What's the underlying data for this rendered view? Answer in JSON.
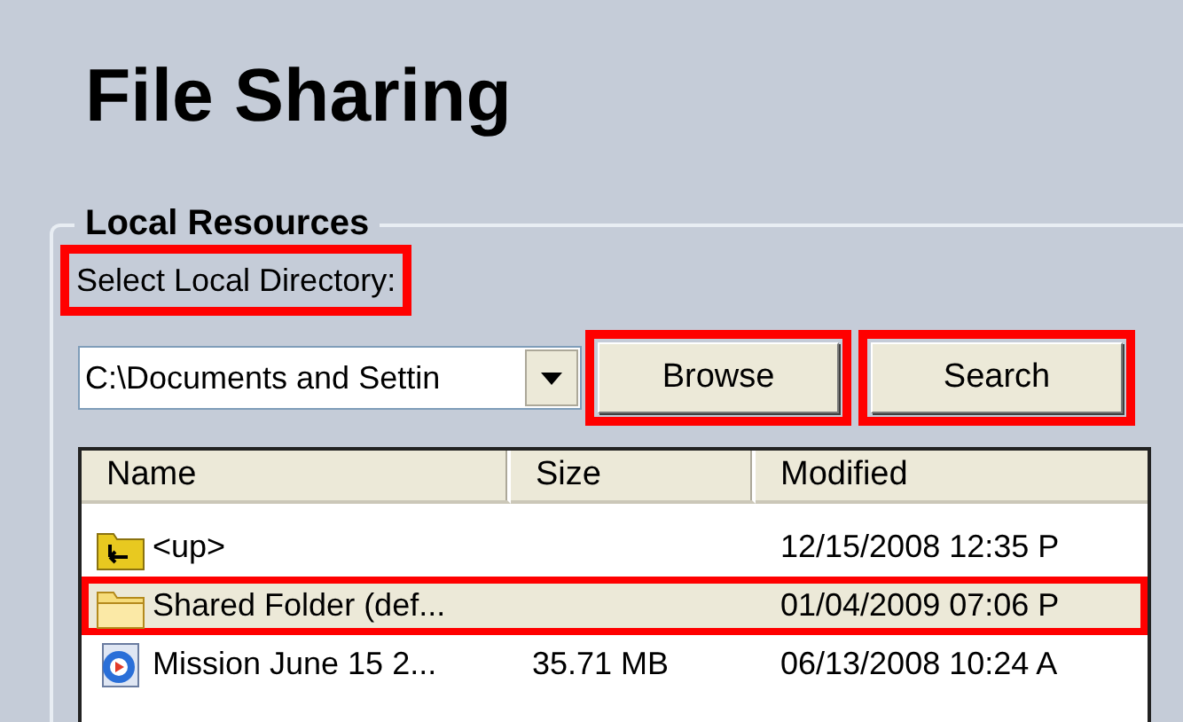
{
  "title": "File Sharing",
  "group": {
    "legend": "Local Resources"
  },
  "directory": {
    "label": "Select Local Directory:",
    "label_highlighted": true,
    "value": "C:\\Documents and Settin"
  },
  "buttons": [
    {
      "label": "Browse",
      "highlighted": true
    },
    {
      "label": "Search",
      "highlighted": true
    }
  ],
  "table": {
    "columns": [
      "Name",
      "Size",
      "Modified"
    ],
    "rows": [
      {
        "kind": "up-folder",
        "name": "<up>",
        "size": "",
        "modified": "12/15/2008 12:35 P",
        "selected": false,
        "highlighted": false
      },
      {
        "kind": "folder",
        "name": "Shared Folder (def...",
        "size": "",
        "modified": "01/04/2009 07:06 P",
        "selected": true,
        "highlighted": true
      },
      {
        "kind": "media",
        "name": "Mission June 15 2...",
        "size": "35.71 MB",
        "modified": "06/13/2008 10:24 A",
        "selected": false,
        "highlighted": false
      }
    ]
  }
}
